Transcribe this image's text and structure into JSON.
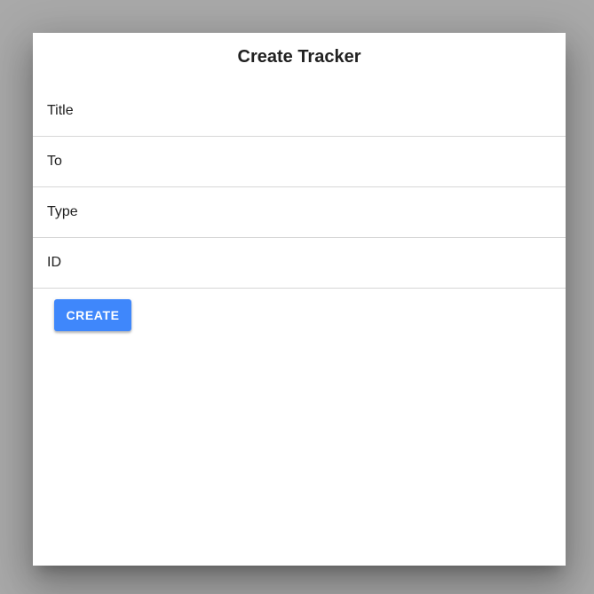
{
  "dialog": {
    "title": "Create Tracker",
    "fields": [
      {
        "placeholder": "Title",
        "value": ""
      },
      {
        "placeholder": "To",
        "value": ""
      },
      {
        "placeholder": "Type",
        "value": ""
      },
      {
        "placeholder": "ID",
        "value": ""
      }
    ],
    "create_label": "CREATE"
  },
  "colors": {
    "backdrop": "#a9a9a9",
    "surface": "#ffffff",
    "primary": "#3f87fb",
    "divider": "#d6d6d6",
    "text": "#212121"
  }
}
